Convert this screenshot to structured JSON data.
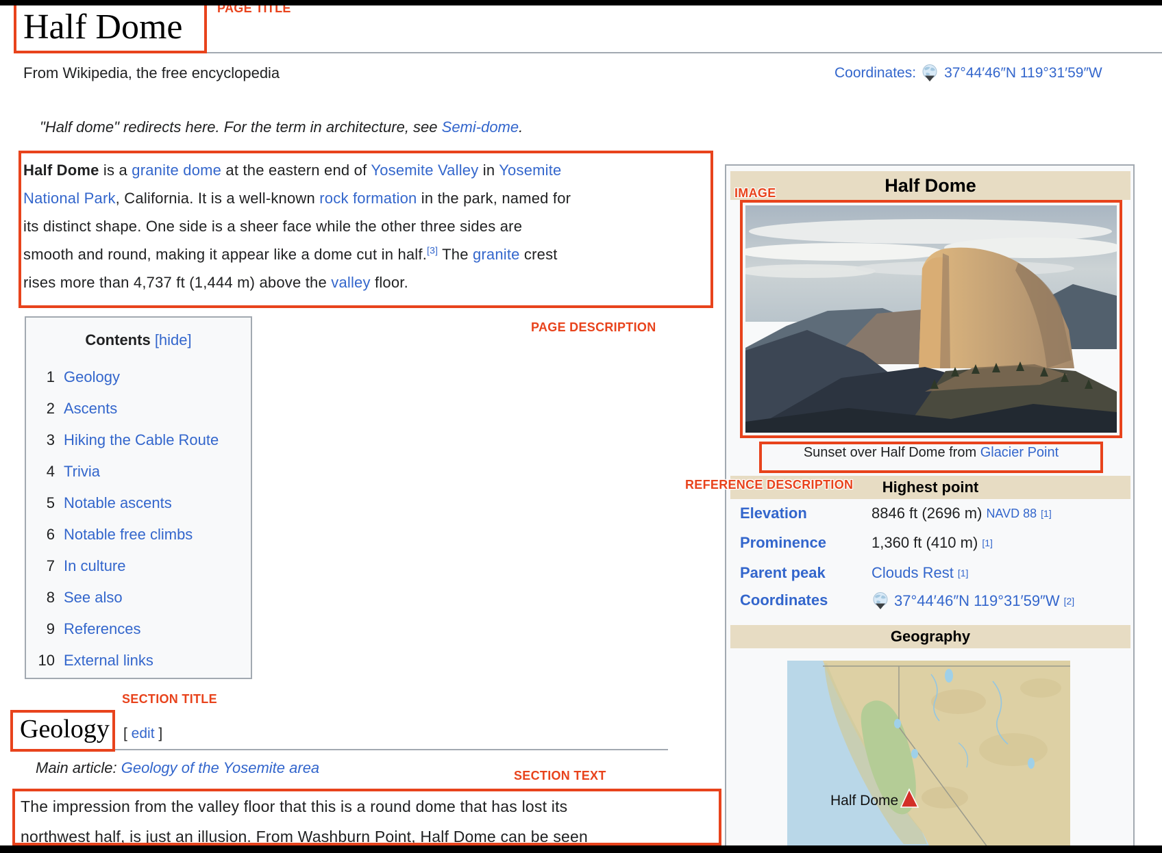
{
  "annotation": {
    "color": "#e8431c",
    "page_title": "PAGE TITLE",
    "image": "IMAGE",
    "page_description": "PAGE DESCRIPTION",
    "reference_description": "REFERENCE DESCRIPTION",
    "section_title": "SECTION TITLE",
    "section_text": "SECTION TEXT"
  },
  "header": {
    "title": "Half Dome",
    "tagline": "From Wikipedia, the free encyclopedia",
    "coordinates_label": "Coordinates:",
    "coordinates_value": "37°44′46″N 119°31′59″W"
  },
  "hatnote": [
    {
      "t": "\"Half dome\" redirects here. For the term in architecture, see ",
      "i": 1
    },
    {
      "t": "Semi-dome",
      "i": 1,
      "l": 1
    },
    {
      "t": ".",
      "i": 1
    }
  ],
  "intro": {
    "lines": [
      [
        {
          "t": "Half Dome",
          "b": 1
        },
        {
          "t": " is a "
        },
        {
          "t": "granite dome",
          "l": 1
        },
        {
          "t": " at the eastern end of "
        },
        {
          "t": "Yosemite Valley",
          "l": 1
        },
        {
          "t": " in "
        },
        {
          "t": "Yosemite",
          "l": 1
        }
      ],
      [
        {
          "t": "National Park",
          "l": 1
        },
        {
          "t": ", California. It is a well-known "
        },
        {
          "t": "rock formation",
          "l": 1
        },
        {
          "t": " in the park, named for"
        }
      ],
      [
        {
          "t": "its distinct shape. One side is a sheer face while the other three sides are"
        }
      ],
      [
        {
          "t": "smooth and round, making it appear like a dome cut in half."
        },
        {
          "t": "[3]",
          "l": 1,
          "sup": 1
        },
        {
          "t": " The "
        },
        {
          "t": "granite",
          "l": 1
        },
        {
          "t": " crest"
        }
      ],
      [
        {
          "t": "rises more than 4,737 ft (1,444 m) above the "
        },
        {
          "t": "valley",
          "l": 1
        },
        {
          "t": " floor."
        }
      ]
    ]
  },
  "toc": {
    "title": "Contents",
    "hide_label": "[hide]",
    "items": [
      {
        "num": "1",
        "label": "Geology"
      },
      {
        "num": "2",
        "label": "Ascents"
      },
      {
        "num": "3",
        "label": "Hiking the Cable Route"
      },
      {
        "num": "4",
        "label": "Trivia"
      },
      {
        "num": "5",
        "label": "Notable ascents"
      },
      {
        "num": "6",
        "label": "Notable free climbs"
      },
      {
        "num": "7",
        "label": "In culture"
      },
      {
        "num": "8",
        "label": "See also"
      },
      {
        "num": "9",
        "label": "References"
      },
      {
        "num": "10",
        "label": "External links"
      }
    ]
  },
  "infobox": {
    "title": "Half Dome",
    "caption": [
      {
        "t": "Sunset over Half Dome from "
      },
      {
        "t": "Glacier Point",
        "l": 1
      }
    ],
    "highest_point_header": "Highest point",
    "geography_header": "Geography",
    "rows": [
      {
        "label": "Elevation",
        "value": [
          {
            "t": "8846 ft (2696 m) "
          },
          {
            "t": "NAVD 88",
            "l": 1,
            "sm": 1
          },
          {
            "t": "[1]",
            "l": 1,
            "sup": 1
          }
        ]
      },
      {
        "label": "Prominence",
        "value": [
          {
            "t": "1,360 ft (410 m) "
          },
          {
            "t": "[1]",
            "l": 1,
            "sup": 1
          }
        ]
      },
      {
        "label": "Parent peak",
        "value": [
          {
            "t": "Clouds Rest",
            "l": 1
          },
          {
            "t": "[1]",
            "l": 1,
            "sup": 1
          }
        ]
      },
      {
        "label": "Coordinates",
        "value": [
          {
            "globe": 1
          },
          {
            "t": "37°44′46″N 119°31′59″W",
            "l": 1
          },
          {
            "t": "[2]",
            "l": 1,
            "sup": 1
          }
        ]
      }
    ],
    "map_label": "Half Dome"
  },
  "geology": {
    "title": "Geology",
    "edit": [
      {
        "t": "[ "
      },
      {
        "t": "edit",
        "l": 1
      },
      {
        "t": " ]"
      }
    ],
    "main_article": [
      {
        "t": "Main article: ",
        "i": 1
      },
      {
        "t": "Geology of the Yosemite area",
        "i": 1,
        "l": 1
      }
    ],
    "lines": [
      "The impression from the valley floor that this is a round dome that has lost its",
      "northwest half, is just an illusion. From Washburn Point, Half Dome can be seen"
    ]
  },
  "colors": {
    "annotation_orange": "#e8431c",
    "link_blue": "#3366cc",
    "infobox_band_tan": "#e7dcc3",
    "box_background": "#f8f9fa",
    "border_gray": "#a2a9b1",
    "map_marker_red": "#d32f27"
  }
}
